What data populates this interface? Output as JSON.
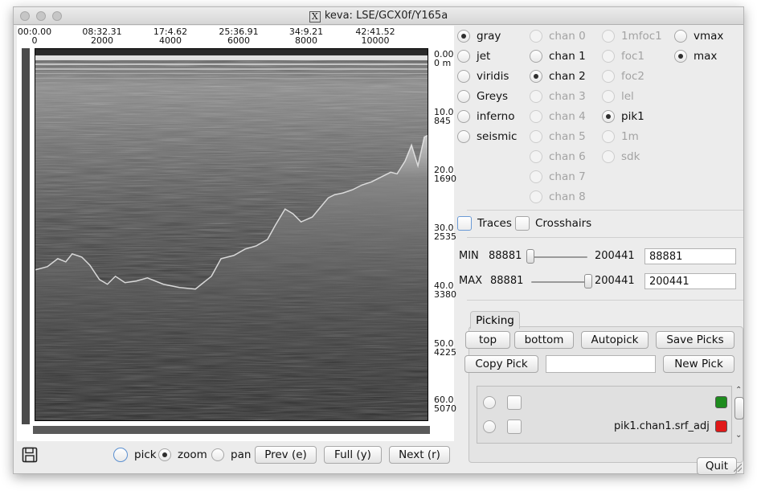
{
  "window": {
    "title": "keva: LSE/GCX0f/Y165a",
    "title_logo": "X"
  },
  "plot": {
    "time_ticks": [
      "00:0.00",
      "08:32.31",
      "17:4.62",
      "25:36.91",
      "34:9.21",
      "42:41.52"
    ],
    "trace_ticks": [
      "0",
      "2000",
      "4000",
      "6000",
      "8000",
      "10000"
    ],
    "depth_ticks": [
      {
        "time": "0.00",
        "depth": "0 m"
      },
      {
        "time": "10.0",
        "depth": "845"
      },
      {
        "time": "20.0",
        "depth": "1690"
      },
      {
        "time": "30.0",
        "depth": "2535"
      },
      {
        "time": "40.0",
        "depth": "3380"
      },
      {
        "time": "50.0",
        "depth": "4225"
      },
      {
        "time": "60.0",
        "depth": "5070"
      }
    ]
  },
  "colormaps": [
    {
      "label": "gray",
      "selected": true
    },
    {
      "label": "jet",
      "selected": false
    },
    {
      "label": "viridis",
      "selected": false
    },
    {
      "label": "Greys",
      "selected": false
    },
    {
      "label": "inferno",
      "selected": false
    },
    {
      "label": "seismic",
      "selected": false
    }
  ],
  "channels": [
    {
      "label": "chan 0",
      "enabled": false,
      "selected": false
    },
    {
      "label": "chan 1",
      "enabled": true,
      "selected": false
    },
    {
      "label": "chan 2",
      "enabled": true,
      "selected": true
    },
    {
      "label": "chan 3",
      "enabled": false,
      "selected": false
    },
    {
      "label": "chan 4",
      "enabled": false,
      "selected": false
    },
    {
      "label": "chan 5",
      "enabled": false,
      "selected": false
    },
    {
      "label": "chan 6",
      "enabled": false,
      "selected": false
    },
    {
      "label": "chan 7",
      "enabled": false,
      "selected": false
    },
    {
      "label": "chan 8",
      "enabled": false,
      "selected": false
    }
  ],
  "products": [
    {
      "label": "1mfoc1",
      "enabled": false,
      "selected": false
    },
    {
      "label": "foc1",
      "enabled": false,
      "selected": false
    },
    {
      "label": "foc2",
      "enabled": false,
      "selected": false
    },
    {
      "label": "lel",
      "enabled": false,
      "selected": false
    },
    {
      "label": "pik1",
      "enabled": true,
      "selected": true
    },
    {
      "label": "1m",
      "enabled": false,
      "selected": false
    },
    {
      "label": "sdk",
      "enabled": false,
      "selected": false
    }
  ],
  "scaling": [
    {
      "label": "vmax",
      "selected": false
    },
    {
      "label": "max",
      "selected": true
    }
  ],
  "overlays": {
    "traces_label": "Traces",
    "traces_checked": false,
    "crosshairs_label": "Crosshairs",
    "crosshairs_checked": false
  },
  "min_slider": {
    "label": "MIN",
    "low": "88881",
    "high": "200441",
    "value": "88881",
    "fraction": 0.0
  },
  "max_slider": {
    "label": "MAX",
    "low": "88881",
    "high": "200441",
    "value": "200441",
    "fraction": 1.0
  },
  "picking": {
    "tab_label": "Picking",
    "buttons": {
      "top": "top",
      "bottom": "bottom",
      "autopick": "Autopick",
      "save": "Save Picks",
      "copy": "Copy Pick",
      "new": "New Pick"
    },
    "pick_name_value": "",
    "rows": [
      {
        "label": "",
        "color": "#1e8c1e"
      },
      {
        "label": "pik1.chan1.srf_adj",
        "color": "#e01818"
      }
    ]
  },
  "navigation": {
    "modes": [
      {
        "label": "pick",
        "selected": false
      },
      {
        "label": "zoom",
        "selected": true
      },
      {
        "label": "pan",
        "selected": false
      }
    ],
    "prev": "Prev (e)",
    "full": "Full (y)",
    "next": "Next (r)"
  },
  "quit_label": "Quit",
  "icons": {
    "save": "floppy-disk-icon"
  }
}
